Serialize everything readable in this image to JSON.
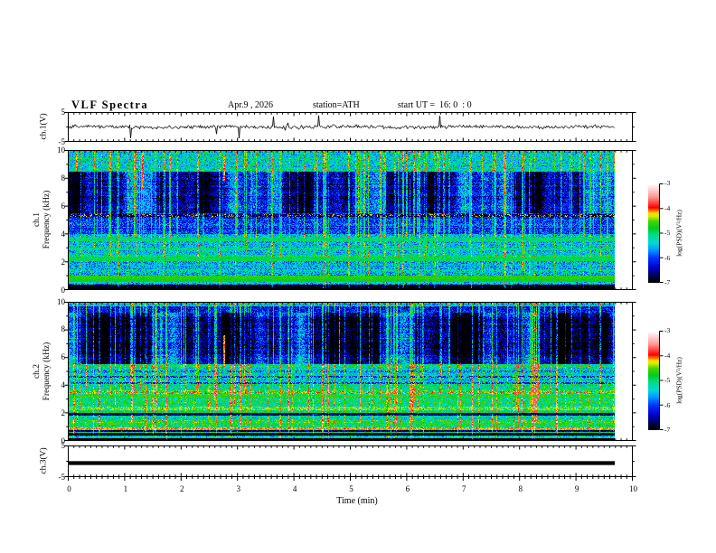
{
  "header": {
    "title": "VLF Spectra",
    "date": "Apr.9 , 2026",
    "station": "station=ATH",
    "start_ut": "start UT =  16: 0  : 0"
  },
  "x_axis": {
    "label": "Time (min)",
    "ticks": [
      0,
      1,
      2,
      3,
      4,
      5,
      6,
      7,
      8,
      9,
      10
    ],
    "range": [
      0,
      10
    ],
    "minor_step": 0.1,
    "data_end_min": 9.83
  },
  "panels": [
    {
      "id": "ch1_wave",
      "ylabel": "ch.1(V)",
      "yticks": [
        5,
        -5
      ],
      "ylim": [
        -5,
        5
      ],
      "type": "line"
    },
    {
      "id": "ch1_spec",
      "ylabel_line1": "ch.1",
      "ylabel_line2": "Frequency (kHz)",
      "yticks": [
        10,
        8,
        6,
        4,
        2,
        0
      ],
      "ylim": [
        0,
        10
      ],
      "type": "spectrogram"
    },
    {
      "id": "ch2_spec",
      "ylabel_line1": "ch.2",
      "ylabel_line2": "Frequency (kHz)",
      "yticks": [
        10,
        8,
        6,
        4,
        2,
        0
      ],
      "ylim": [
        0,
        10
      ],
      "type": "spectrogram"
    },
    {
      "id": "ch3_wave",
      "ylabel": "ch.3(V)",
      "yticks": [
        5,
        -5
      ],
      "ylim": [
        -5,
        5
      ],
      "type": "line"
    }
  ],
  "colorbar": {
    "label": "log(PSD)(V²/Hz)",
    "ticks": [
      -3,
      -4,
      -5,
      -6,
      -7
    ],
    "top_value": -3,
    "bottom_value": -7,
    "gradient_stops": [
      [
        0.0,
        "#000000"
      ],
      [
        0.07,
        "#000055"
      ],
      [
        0.15,
        "#0000cc"
      ],
      [
        0.25,
        "#0033ff"
      ],
      [
        0.33,
        "#0099ff"
      ],
      [
        0.4,
        "#00d8d8"
      ],
      [
        0.48,
        "#00dd88"
      ],
      [
        0.55,
        "#00cc22"
      ],
      [
        0.62,
        "#44d400"
      ],
      [
        0.67,
        "#ccee00"
      ],
      [
        0.7,
        "#ffdd00"
      ],
      [
        0.73,
        "#ff6600"
      ],
      [
        0.76,
        "#ff0000"
      ],
      [
        0.87,
        "#ff9999"
      ],
      [
        1.0,
        "#ffffff"
      ]
    ]
  },
  "chart_data": [
    {
      "id": "ch1_wave",
      "type": "line",
      "title": "ch.1(V) broadband amplitude",
      "ylim": [
        -5,
        5
      ],
      "baseline_V": 0,
      "noise_amplitude_V": 0.8,
      "data_end_min": 9.83,
      "notable_spike_times_min": [
        0.55,
        1.3,
        2.0,
        2.4,
        3.0,
        4.25,
        5.3,
        6.3,
        7.15,
        8.6
      ],
      "max_spike_V": -4.5,
      "spike_probability": 0.013,
      "line_color": "#000000"
    },
    {
      "id": "ch1_spec",
      "type": "heatmap",
      "ylabel": "ch.1 Frequency (kHz)",
      "ylim": [
        0,
        10
      ],
      "zlabel": "log(PSD)(V²/Hz)",
      "zlim": [
        -7,
        -3
      ],
      "data_end_min": 9.83,
      "background_profile": [
        [
          0,
          0.32,
          -7.3
        ],
        [
          0.32,
          0.55,
          -5.6
        ],
        [
          0.55,
          1.0,
          -5.15
        ],
        [
          1.0,
          2.0,
          -5.5
        ],
        [
          2.0,
          2.45,
          -5.1
        ],
        [
          2.45,
          4.0,
          -5.45
        ],
        [
          4.0,
          5.25,
          -6.05
        ],
        [
          5.25,
          5.5,
          -6.3
        ],
        [
          5.5,
          8.5,
          -6.4
        ],
        [
          8.5,
          10.01,
          -5.3
        ]
      ],
      "horizontal_bands": [
        [
          5.33,
          0.08,
          -4.25,
          0.22
        ],
        [
          5.33,
          0.08,
          -6.9,
          0.4
        ],
        [
          3.6,
          0.12,
          -5.0,
          0.9
        ],
        [
          2.9,
          0.08,
          -5.05,
          0.8
        ],
        [
          2.2,
          0.18,
          -4.95,
          1.0
        ],
        [
          1.35,
          0.06,
          -5.15,
          0.7
        ],
        [
          0.85,
          0.1,
          -4.65,
          1.0
        ],
        [
          0.62,
          0.07,
          -4.75,
          1.0
        ],
        [
          0.45,
          0.05,
          -5.3,
          0.6
        ]
      ],
      "vertical_streaks": {
        "count": 120,
        "level_boost": 1.15,
        "full_height_fraction": 0.35
      },
      "hot_streaks": [
        [
          0.13,
          8.5,
          9.9
        ],
        [
          1.32,
          7.2,
          9.9
        ],
        [
          2.78,
          7.8,
          9.7
        ]
      ],
      "dark_patch_region_khz": [
        5.5,
        8.5
      ],
      "dark_patch_amp": 0.5
    },
    {
      "id": "ch2_spec",
      "type": "heatmap",
      "ylabel": "ch.2 Frequency (kHz)",
      "ylim": [
        0,
        10
      ],
      "zlabel": "log(PSD)(V²/Hz)",
      "zlim": [
        -7,
        -3
      ],
      "data_end_min": 9.83,
      "background_profile": [
        [
          0,
          0.12,
          -7.3
        ],
        [
          0.12,
          0.3,
          -5.4
        ],
        [
          0.3,
          0.5,
          -7.0
        ],
        [
          0.5,
          0.62,
          -5.1
        ],
        [
          0.62,
          0.75,
          -6.6
        ],
        [
          0.75,
          0.95,
          -4.6
        ],
        [
          0.95,
          1.45,
          -4.95
        ],
        [
          1.45,
          1.8,
          -5.2
        ],
        [
          1.8,
          1.95,
          -6.5
        ],
        [
          1.95,
          3.3,
          -5.0
        ],
        [
          3.3,
          3.6,
          -4.9
        ],
        [
          3.6,
          4.1,
          -5.15
        ],
        [
          4.1,
          5.3,
          -5.35
        ],
        [
          5.3,
          5.5,
          -5.05
        ],
        [
          5.5,
          6.2,
          -6.45
        ],
        [
          6.2,
          9.0,
          -6.75
        ],
        [
          9.0,
          9.75,
          -6.3
        ],
        [
          9.75,
          10.01,
          -5.4
        ]
      ],
      "horizontal_bands": [
        [
          3.45,
          0.12,
          -4.1,
          0.45
        ],
        [
          3.2,
          0.1,
          -4.6,
          0.8
        ],
        [
          2.3,
          0.12,
          -4.35,
          0.5
        ],
        [
          2.05,
          0.06,
          -4.8,
          0.6
        ],
        [
          1.2,
          0.08,
          -4.6,
          0.8
        ],
        [
          0.85,
          0.08,
          -4.15,
          0.7
        ],
        [
          1.88,
          0.07,
          -6.7,
          0.9
        ],
        [
          4.15,
          0.07,
          -6.3,
          0.5
        ],
        [
          4.62,
          0.07,
          -6.4,
          0.5
        ],
        [
          4.62,
          0.05,
          -4.6,
          0.1
        ],
        [
          5.0,
          0.05,
          -6.1,
          0.3
        ],
        [
          0.38,
          0.07,
          -7.2,
          0.9
        ],
        [
          0.2,
          0.06,
          -5.2,
          0.5
        ]
      ],
      "vertical_streaks": {
        "count": 135,
        "level_boost": 1.35,
        "full_height_fraction": 0.4
      },
      "hot_streaks": [
        [
          2.78,
          5.3,
          7.6
        ]
      ],
      "dark_patch_region_khz": [
        5.5,
        9.3
      ],
      "dark_patch_amp": 0.55
    },
    {
      "id": "ch3_wave",
      "type": "line",
      "title": "ch.3(V) flat trace",
      "ylim": [
        -5,
        5
      ],
      "constant_value_V": -0.6,
      "line_thickness_V": 1.3,
      "data_end_min": 9.83,
      "line_color": "#000000"
    }
  ]
}
